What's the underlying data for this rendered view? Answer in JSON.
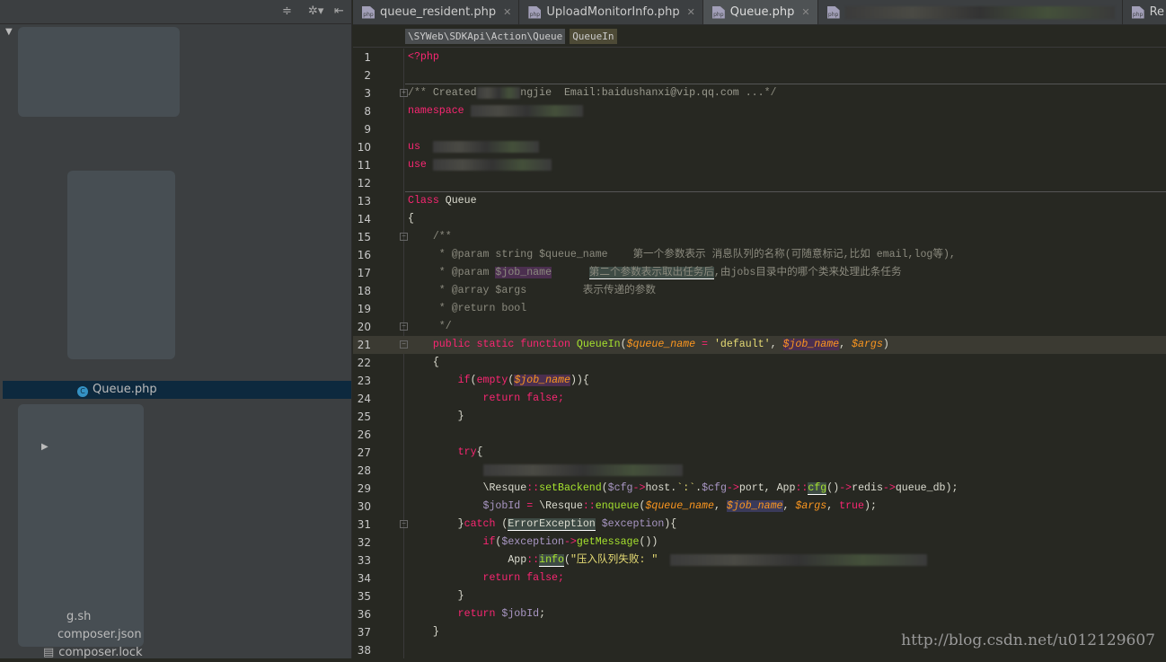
{
  "sidebar": {
    "items": [
      {
        "label": "Queue.php",
        "selected": true
      },
      {
        "label": "g.sh"
      },
      {
        "label": "composer.json"
      },
      {
        "label": "composer.lock"
      }
    ],
    "tools": [
      "collapse-icon",
      "gear-icon",
      "hide-icon"
    ]
  },
  "tabs": [
    {
      "label": "queue_resident.php",
      "active": false
    },
    {
      "label": "UploadMonitorInfo.php",
      "active": false
    },
    {
      "label": "Queue.php",
      "active": true
    },
    {
      "label": "",
      "active": false
    },
    {
      "label": "Re",
      "active": false
    }
  ],
  "breadcrumbs": [
    "\\SYWeb\\SDKApi\\Action\\Queue",
    "QueueIn"
  ],
  "editor": {
    "current_line": 21,
    "lines": [
      {
        "n": 1,
        "t": [
          [
            "k",
            "<?php"
          ]
        ]
      },
      {
        "n": 2,
        "t": []
      },
      {
        "n": 3,
        "fold": "+",
        "t": [
          [
            "c",
            "/**"
          ],
          [
            "cn",
            " Created"
          ],
          [
            "b",
            "       "
          ],
          [
            "cn",
            "ngjie  Email:baidushanxi@vip.qq.com ..."
          ],
          [
            "c",
            "*/"
          ]
        ]
      },
      {
        "n": 8,
        "t": [
          [
            "k",
            "namespace"
          ],
          [
            "p",
            " "
          ],
          [
            "b",
            "                  "
          ]
        ]
      },
      {
        "n": 9,
        "t": []
      },
      {
        "n": 10,
        "t": [
          [
            "k",
            "us"
          ],
          [
            "p",
            "  "
          ],
          [
            "b",
            "                 "
          ]
        ]
      },
      {
        "n": 11,
        "t": [
          [
            "k",
            "use"
          ],
          [
            "p",
            " "
          ],
          [
            "b",
            "                   "
          ]
        ]
      },
      {
        "n": 12,
        "t": []
      },
      {
        "n": 13,
        "t": [
          [
            "k",
            "Class"
          ],
          [
            "p",
            " Queue"
          ]
        ]
      },
      {
        "n": 14,
        "t": [
          [
            "p",
            "{"
          ]
        ]
      },
      {
        "n": 15,
        "fold": "-",
        "t": [
          [
            "c",
            "    /**"
          ]
        ]
      },
      {
        "n": 16,
        "t": [
          [
            "c",
            "     * @param string $queue_name    第一个参数表示 消息队列的名称(可随意标记,比如 email,log等),"
          ]
        ]
      },
      {
        "n": 17,
        "t": [
          [
            "c",
            "     * @param "
          ],
          [
            "c hv",
            "$job_name"
          ],
          [
            "c",
            "      "
          ],
          [
            "c hg",
            "第二个参数表示取出任务后"
          ],
          [
            "c",
            ",由jobs目录中的哪个类来处理此条任务"
          ]
        ]
      },
      {
        "n": 18,
        "t": [
          [
            "c",
            "     * @array $args         表示传递的参数"
          ]
        ]
      },
      {
        "n": 19,
        "t": [
          [
            "c",
            "     * @return bool"
          ]
        ]
      },
      {
        "n": 20,
        "fold": "-",
        "t": [
          [
            "c",
            "     */"
          ]
        ]
      },
      {
        "n": 21,
        "fold": "-",
        "t": [
          [
            "p",
            "    "
          ],
          [
            "k",
            "public static function "
          ],
          [
            "f",
            "QueueIn"
          ],
          [
            "p",
            "("
          ],
          [
            "v",
            "$queue_name"
          ],
          [
            "o",
            " = "
          ],
          [
            "s",
            "'default'"
          ],
          [
            "p",
            ", "
          ],
          [
            "v hv",
            "$job_name"
          ],
          [
            "p",
            ", "
          ],
          [
            "v",
            "$args"
          ],
          [
            "p",
            ")"
          ]
        ]
      },
      {
        "n": 22,
        "t": [
          [
            "p",
            "    {"
          ]
        ]
      },
      {
        "n": 23,
        "t": [
          [
            "p",
            "        "
          ],
          [
            "k",
            "if"
          ],
          [
            "p",
            "("
          ],
          [
            "k",
            "empty"
          ],
          [
            "p",
            "("
          ],
          [
            "v hv",
            "$job_name"
          ],
          [
            "p",
            "))"
          ],
          [
            "p",
            "{"
          ]
        ]
      },
      {
        "n": 24,
        "t": [
          [
            "p",
            "            "
          ],
          [
            "k",
            "return false;"
          ]
        ]
      },
      {
        "n": 25,
        "t": [
          [
            "p",
            "        }"
          ]
        ]
      },
      {
        "n": 26,
        "t": []
      },
      {
        "n": 27,
        "t": [
          [
            "p",
            "        "
          ],
          [
            "k",
            "try"
          ],
          [
            "p",
            "{"
          ]
        ]
      },
      {
        "n": 28,
        "t": [
          [
            "p",
            "            "
          ],
          [
            "b",
            "                                "
          ]
        ]
      },
      {
        "n": 29,
        "t": [
          [
            "p",
            "            \\Resque"
          ],
          [
            "o",
            "::"
          ],
          [
            "f",
            "setBackend"
          ],
          [
            "p",
            "("
          ],
          [
            "l",
            "$cfg"
          ],
          [
            "o",
            "->"
          ],
          [
            "p",
            "host."
          ],
          [
            "s",
            "`:`"
          ],
          [
            "p",
            "."
          ],
          [
            "l",
            "$cfg"
          ],
          [
            "o",
            "->"
          ],
          [
            "p",
            "port, App"
          ],
          [
            "o",
            "::"
          ],
          [
            "f hg",
            "cfg"
          ],
          [
            "p",
            "()"
          ],
          [
            "o",
            "->"
          ],
          [
            "p",
            "redis"
          ],
          [
            "o",
            "->"
          ],
          [
            "p",
            "queue_db);"
          ]
        ]
      },
      {
        "n": 30,
        "t": [
          [
            "p",
            "            "
          ],
          [
            "l",
            "$jobId"
          ],
          [
            "o",
            " = "
          ],
          [
            "p",
            "\\Resque"
          ],
          [
            "o",
            "::"
          ],
          [
            "f",
            "enqueue"
          ],
          [
            "p",
            "("
          ],
          [
            "v",
            "$queue_name"
          ],
          [
            "p",
            ", "
          ],
          [
            "v hb",
            "$job_name"
          ],
          [
            "p",
            ", "
          ],
          [
            "v",
            "$args"
          ],
          [
            "p",
            ", "
          ],
          [
            "k",
            "true"
          ],
          [
            "p",
            ");"
          ]
        ]
      },
      {
        "n": 31,
        "fold": "-",
        "t": [
          [
            "p",
            "        }"
          ],
          [
            "k",
            "catch"
          ],
          [
            "p",
            " ("
          ],
          [
            "p hg",
            "ErrorException"
          ],
          [
            "l",
            " $exception"
          ],
          [
            "p",
            "){"
          ]
        ]
      },
      {
        "n": 32,
        "t": [
          [
            "p",
            "            "
          ],
          [
            "k",
            "if"
          ],
          [
            "p",
            "("
          ],
          [
            "l",
            "$exception"
          ],
          [
            "o",
            "->"
          ],
          [
            "f",
            "getMessage"
          ],
          [
            "p",
            "())"
          ]
        ]
      },
      {
        "n": 33,
        "t": [
          [
            "p",
            "                App"
          ],
          [
            "o",
            "::"
          ],
          [
            "f hg",
            "info"
          ],
          [
            "p",
            "("
          ],
          [
            "s",
            "\"压入队列失败: \""
          ],
          [
            "p",
            "  "
          ],
          [
            "b",
            "                                         "
          ]
        ]
      },
      {
        "n": 34,
        "t": [
          [
            "p",
            "            "
          ],
          [
            "k",
            "return false;"
          ]
        ]
      },
      {
        "n": 35,
        "t": [
          [
            "p",
            "        }"
          ]
        ]
      },
      {
        "n": 36,
        "t": [
          [
            "p",
            "        "
          ],
          [
            "k",
            "return "
          ],
          [
            "l",
            "$jobId"
          ],
          [
            "p",
            ";"
          ]
        ]
      },
      {
        "n": 37,
        "t": [
          [
            "p",
            "    }"
          ]
        ]
      },
      {
        "n": 38,
        "t": []
      }
    ]
  },
  "watermark": "http://blog.csdn.net/u012129607"
}
